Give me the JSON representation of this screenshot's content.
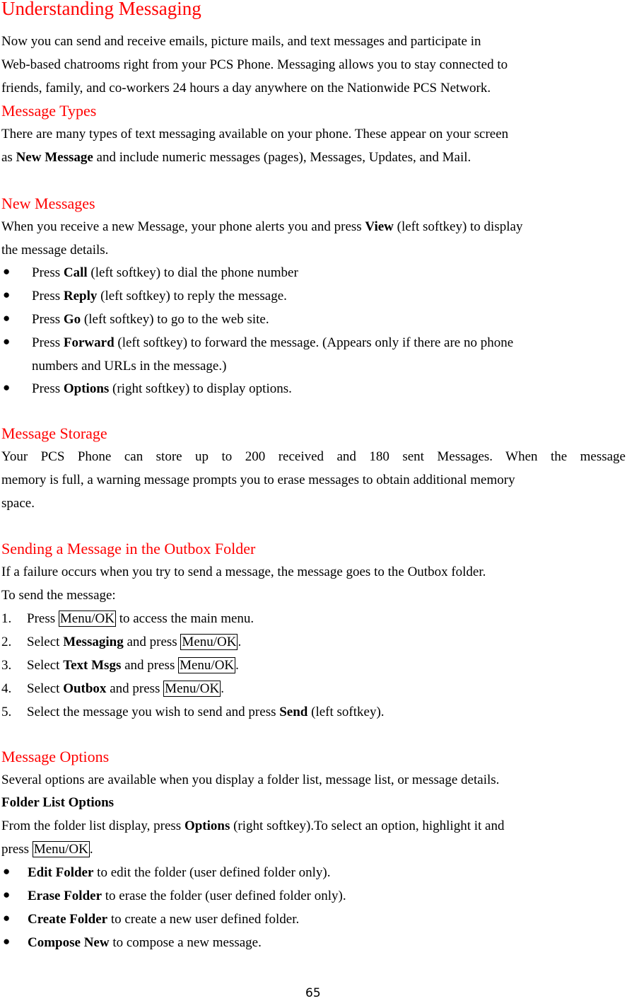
{
  "title": "Understanding Messaging",
  "intro": [
    "Now you can send and receive emails, picture mails, and text messages and participate in",
    "Web-based chatrooms right from your PCS Phone. Messaging allows you to stay connected to",
    "friends, family, and co-workers 24 hours a day anywhere on the Nationwide PCS Network."
  ],
  "types": {
    "heading": "Message Types",
    "line1": "There are many types of text messaging available on your phone. These appear on your screen",
    "line2_pre": "as ",
    "line2_bold": "New Message",
    "line2_post": " and include numeric messages (pages), Messages, Updates, and Mail."
  },
  "new_messages": {
    "heading": "New Messages",
    "line1_pre": "When you receive a new Message, your phone alerts you and press ",
    "line1_bold": "View",
    "line1_post": " (left softkey) to display",
    "line2": "the message details.",
    "bullets": [
      {
        "pre": "Press ",
        "bold": "Call",
        "post": " (left softkey) to dial the phone number"
      },
      {
        "pre": "Press ",
        "bold": "Reply",
        "post": " (left softkey) to reply the message."
      },
      {
        "pre": "Press ",
        "bold": "Go",
        "post": " (left softkey) to go to the web site."
      },
      {
        "pre": "Press ",
        "bold": "Forward",
        "post": " (left softkey) to forward the message. (Appears only if there are no phone",
        "cont": "numbers and URLs in the message.)"
      },
      {
        "pre": "Press ",
        "bold": "Options",
        "post": " (right softkey) to display options."
      }
    ]
  },
  "storage": {
    "heading": "Message Storage",
    "lines": [
      "Your PCS Phone can store up to 200 received and 180 sent Messages. When the message",
      "memory is full, a warning message prompts you to erase messages to obtain additional memory",
      "space."
    ]
  },
  "outbox": {
    "heading": "Sending a Message in the Outbox Folder",
    "line1": "If a failure occurs when you try to send a message, the message goes to the Outbox folder.",
    "line2": "To send the message:",
    "key": "Menu/OK",
    "steps": [
      {
        "num": "1.",
        "pre": "Press ",
        "bold": "",
        "mid": "",
        "post": " to access the main menu."
      },
      {
        "num": "2.",
        "pre": "Select ",
        "bold": "Messaging",
        "mid": " and press ",
        "post": "."
      },
      {
        "num": "3.",
        "pre": "Select ",
        "bold": "Text Msgs",
        "mid": " and press ",
        "post": "."
      },
      {
        "num": "4.",
        "pre": "Select ",
        "bold": "Outbox",
        "mid": " and press ",
        "post": "."
      },
      {
        "num": "5.",
        "pre": "Select the message you wish to send and press ",
        "bold": "Send",
        "mid": "",
        "post": " (left softkey)."
      }
    ]
  },
  "options": {
    "heading": "Message Options",
    "line1": "Several options are available when you display a folder list, message list, or message details.",
    "subheading": "Folder List Options",
    "line2_pre": "From the folder list display, press ",
    "line2_bold": "Options",
    "line2_post": " (right softkey).To select an option, highlight it and",
    "line3_pre": "press ",
    "line3_post": ".",
    "bullets": [
      {
        "bold": "Edit Folder",
        "post": " to edit the folder (user defined folder only)."
      },
      {
        "bold": "Erase Folder",
        "post": " to erase the folder (user defined folder only)."
      },
      {
        "bold": "Create Folder",
        "post": " to create a new user defined folder."
      },
      {
        "bold": "Compose New",
        "post": " to compose a new message."
      }
    ]
  },
  "page_number": "65",
  "colors": {
    "heading": "#ff0000",
    "text": "#000000"
  }
}
